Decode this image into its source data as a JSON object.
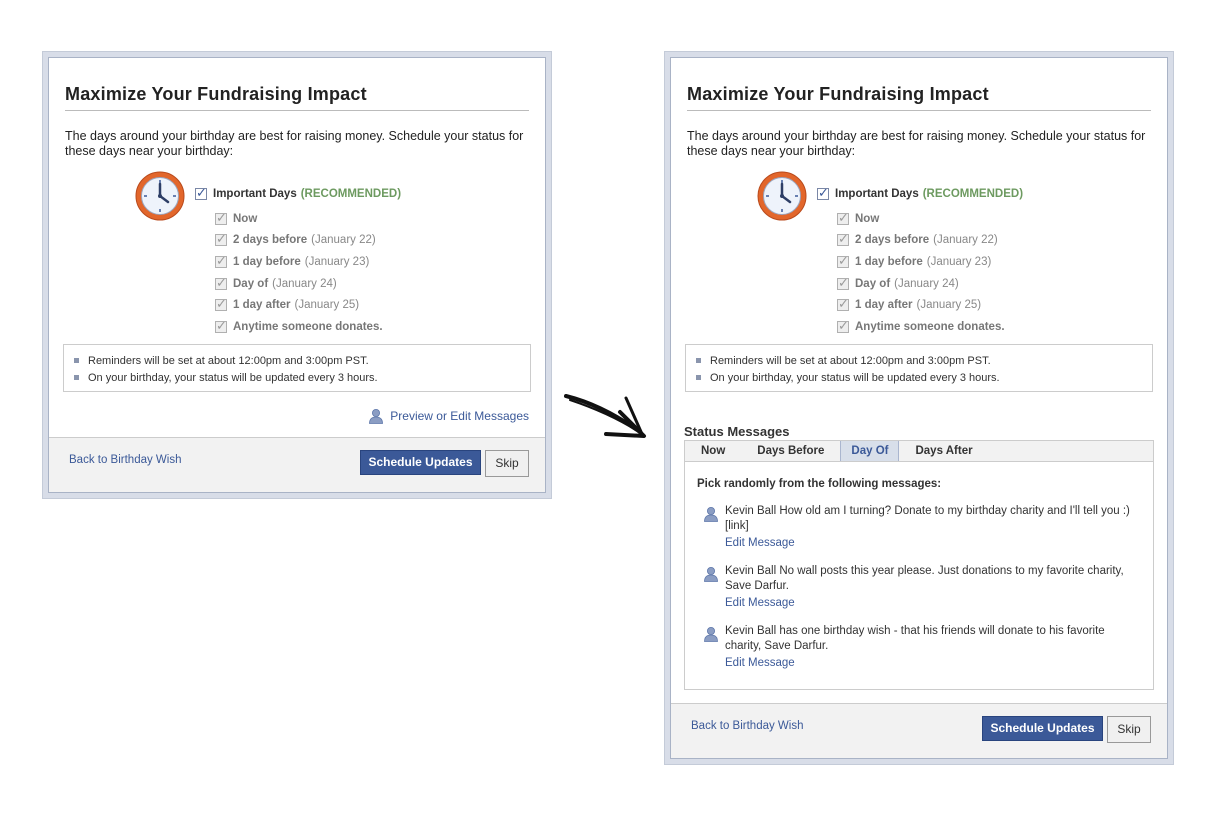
{
  "dialog": {
    "title": "Maximize Your Fundraising Impact",
    "intro": "The days around your birthday are best for raising money. Schedule your status for these days near your birthday:",
    "important_label": "Important Days",
    "recommended": "(RECOMMENDED)",
    "options": [
      {
        "bold": "Now",
        "date": ""
      },
      {
        "bold": "2 days before",
        "date": "(January 22)"
      },
      {
        "bold": "1 day before",
        "date": "(January 23)"
      },
      {
        "bold": "Day of",
        "date": "(January 24)"
      },
      {
        "bold": "1 day after",
        "date": "(January 25)"
      },
      {
        "bold": "Anytime someone donates.",
        "date": ""
      }
    ],
    "notes": [
      "Reminders will be set at about 12:00pm and 3:00pm PST.",
      "On your birthday, your status will be updated every 3 hours."
    ],
    "preview_link": "Preview or Edit Messages",
    "back_link": "Back to Birthday Wish",
    "schedule_button": "Schedule Updates",
    "skip_button": "Skip"
  },
  "status_messages": {
    "heading": "Status Messages",
    "tabs": [
      "Now",
      "Days Before",
      "Day Of",
      "Days After"
    ],
    "active_tab": "Day Of",
    "pick_label": "Pick randomly from the following messages:",
    "messages": [
      {
        "text": "Kevin Ball How old am I turning? Donate to my birthday charity and I'll tell you :) [link]",
        "edit": "Edit Message"
      },
      {
        "text": "Kevin Ball No wall posts this year please. Just donations to my favorite charity, Save Darfur.",
        "edit": "Edit Message"
      },
      {
        "text": "Kevin Ball has one birthday wish - that his friends will donate to his favorite charity, Save Darfur.",
        "edit": "Edit Message"
      }
    ]
  },
  "icons": {
    "clock": "clock-icon",
    "person": "person-icon",
    "arrow": "transition-arrow-icon"
  },
  "colors": {
    "link": "#3b5998",
    "button": "#3b5998",
    "recommended": "#6d9a60",
    "clock_orange": "#e2662b"
  }
}
